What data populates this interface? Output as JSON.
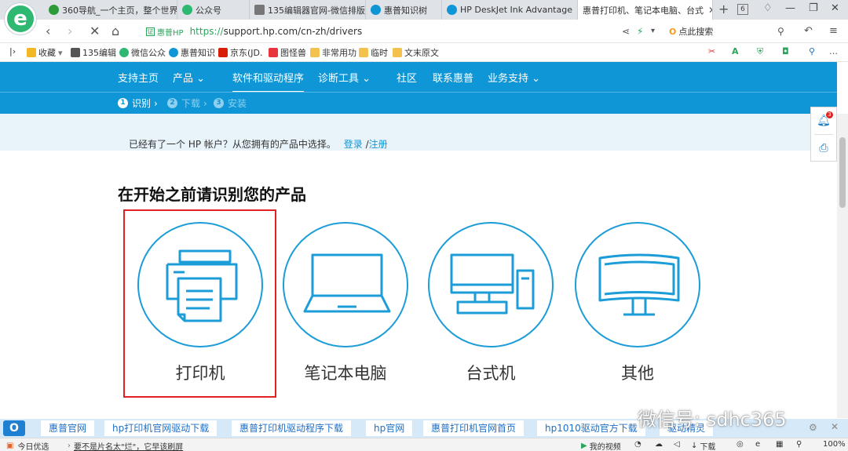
{
  "browser": {
    "logo_letter": "e",
    "tabs": [
      {
        "title": "360导航_一个主页，整个世界",
        "icon_color": "#2d9b3a"
      },
      {
        "title": "公众号",
        "icon_color": "#2eb872"
      },
      {
        "title": "135编辑器官网-微信排版编辑",
        "icon_color": "#777777"
      },
      {
        "title": "惠普知识树",
        "icon_color": "#0f96d6"
      },
      {
        "title": "HP DeskJet Ink Advantage",
        "icon_color": "#0f96d6"
      },
      {
        "title": "惠普打印机、笔记本电脑、台式",
        "icon_color": "#0f96d6"
      }
    ],
    "tab_count": "6",
    "address": {
      "secure_label": "惠普HP",
      "url_scheme": "https://",
      "url_rest": "support.hp.com/cn-zh/drivers"
    },
    "search_placeholder": "点此搜索",
    "bookmarks": [
      {
        "label": "收藏",
        "icon_color": "#f2b824"
      },
      {
        "label": "135编辑",
        "icon_color": "#555555"
      },
      {
        "label": "微信公众",
        "icon_color": "#2eb872"
      },
      {
        "label": "惠普知识",
        "icon_color": "#0f96d6"
      },
      {
        "label": "京东(JD.",
        "icon_color": "#d81e06"
      },
      {
        "label": "图怪兽",
        "icon_color": "#e8353b"
      },
      {
        "label": "非常用功",
        "icon_color": "#f2c14e"
      },
      {
        "label": "临时",
        "icon_color": "#f2c14e"
      },
      {
        "label": "文末原文",
        "icon_color": "#f2c14e"
      }
    ]
  },
  "hp": {
    "nav": [
      "支持主页",
      "产品",
      "软件和驱动程序",
      "诊断工具",
      "社区",
      "联系惠普",
      "业务支持"
    ],
    "steps": [
      {
        "num": "1",
        "label": "识别"
      },
      {
        "num": "2",
        "label": "下载"
      },
      {
        "num": "3",
        "label": "安装"
      }
    ],
    "account_text": "已经有了一个 HP 帐户？从您拥有的产品中选择。",
    "login_label": "登录",
    "slash": "/",
    "register_label": "注册",
    "heading": "在开始之前请识别您的产品",
    "products": [
      {
        "label": "打印机",
        "icon": "printer-icon"
      },
      {
        "label": "笔记本电脑",
        "icon": "laptop-icon"
      },
      {
        "label": "台式机",
        "icon": "desktop-icon"
      },
      {
        "label": "其他",
        "icon": "monitor-icon"
      }
    ],
    "notification_count": "3"
  },
  "quicklinks": [
    "惠普官网",
    "hp打印机官网驱动下载",
    "惠普打印机驱动程序下载",
    "hp官网",
    "惠普打印机官网首页",
    "hp1010驱动官方下载",
    "驱动精灵"
  ],
  "watermark": "微信号: sdhc365",
  "status": {
    "left": "今日优选",
    "news": "要不是片名太\"烂\"，它早该刷屏",
    "video": "我的视频",
    "download": "下载",
    "zoom": "100%"
  }
}
